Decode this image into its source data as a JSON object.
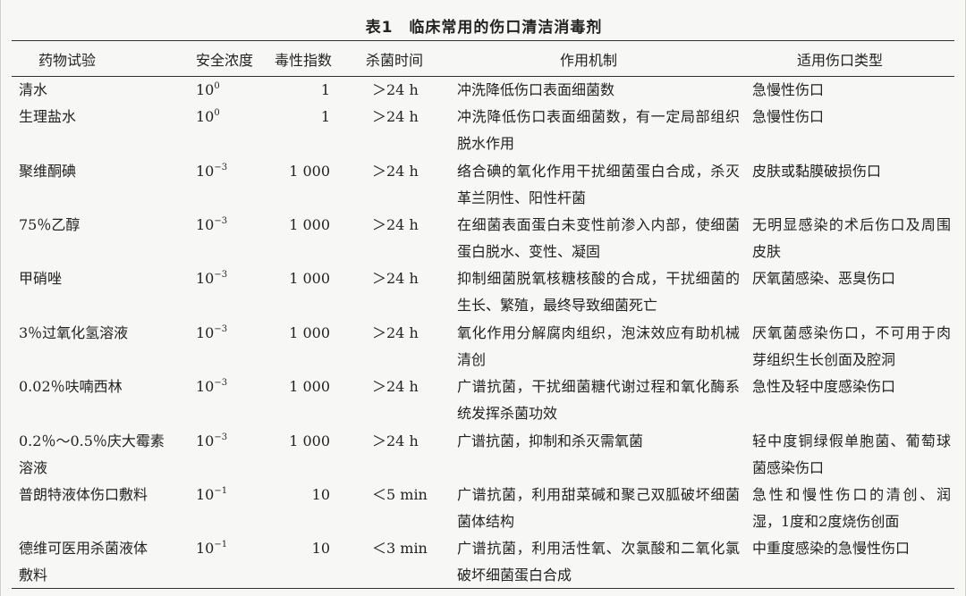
{
  "table": {
    "caption": "表1　临床常用的伤口清洁消毒剂",
    "headers": [
      "药物试验",
      "安全浓度",
      "毒性指数",
      "杀菌时间",
      "作用机制",
      "适用伤口类型"
    ],
    "rows": [
      {
        "drug": [
          "清水"
        ],
        "conc_base": "10",
        "conc_exp": "0",
        "toxicity": "1",
        "time": "＞24 h",
        "mechanism": "冲洗降低伤口表面细菌数",
        "wound_type": "急慢性伤口"
      },
      {
        "drug": [
          "生理盐水"
        ],
        "conc_base": "10",
        "conc_exp": "0",
        "toxicity": "1",
        "time": "＞24 h",
        "mechanism": "冲洗降低伤口表面细菌数，有一定局部组织脱水作用",
        "wound_type": "急慢性伤口"
      },
      {
        "drug": [
          "聚维酮碘"
        ],
        "conc_base": "10",
        "conc_exp": "−3",
        "toxicity": "1 000",
        "time": "＞24 h",
        "mechanism": "络合碘的氧化作用干扰细菌蛋白合成，杀灭革兰阴性、阳性杆菌",
        "wound_type": "皮肤或黏膜破损伤口"
      },
      {
        "drug": [
          "75％乙醇"
        ],
        "conc_base": "10",
        "conc_exp": "−3",
        "toxicity": "1 000",
        "time": "＞24 h",
        "mechanism": "在细菌表面蛋白未变性前渗入内部，使细菌蛋白脱水、变性、凝固",
        "wound_type": "无明显感染的术后伤口及周围皮肤"
      },
      {
        "drug": [
          "甲硝唑"
        ],
        "conc_base": "10",
        "conc_exp": "−3",
        "toxicity": "1 000",
        "time": "＞24 h",
        "mechanism": "抑制细菌脱氧核糖核酸的合成，干扰细菌的生长、繁殖，最终导致细菌死亡",
        "wound_type": "厌氧菌感染、恶臭伤口"
      },
      {
        "drug": [
          "3％过氧化氢溶液"
        ],
        "conc_base": "10",
        "conc_exp": "−3",
        "toxicity": "1 000",
        "time": "＞24 h",
        "mechanism": "氧化作用分解腐肉组织，泡沫效应有助机械清创",
        "wound_type": "厌氧菌感染伤口，不可用于肉芽组织生长创面及腔洞"
      },
      {
        "drug": [
          "0.02％呋喃西林"
        ],
        "conc_base": "10",
        "conc_exp": "−3",
        "toxicity": "1 000",
        "time": "＞24 h",
        "mechanism": "广谱抗菌，干扰细菌糖代谢过程和氧化酶系统发挥杀菌功效",
        "wound_type": "急性及轻中度感染伤口"
      },
      {
        "drug": [
          "0.2％～0.5％庆大霉素",
          "溶液"
        ],
        "conc_base": "10",
        "conc_exp": "−3",
        "toxicity": "1 000",
        "time": "＞24 h",
        "mechanism": "广谱抗菌，抑制和杀灭需氧菌",
        "wound_type": "轻中度铜绿假单胞菌、葡萄球菌感染伤口"
      },
      {
        "drug": [
          "普朗特液体伤口敷料"
        ],
        "conc_base": "10",
        "conc_exp": "−1",
        "toxicity": "10",
        "time": "＜5 min",
        "mechanism": "广谱抗菌，利用甜菜碱和聚己双胍破坏细菌菌体结构",
        "wound_type": "急性和慢性伤口的清创、润湿，1度和2度烧伤创面"
      },
      {
        "drug": [
          "德维可医用杀菌液体",
          "敷料"
        ],
        "conc_base": "10",
        "conc_exp": "−1",
        "toxicity": "10",
        "time": "＜3 min",
        "mechanism": "广谱抗菌，利用活性氧、次氯酸和二氧化氯破坏细菌蛋白合成",
        "wound_type": "中重度感染的急慢性伤口"
      }
    ]
  }
}
